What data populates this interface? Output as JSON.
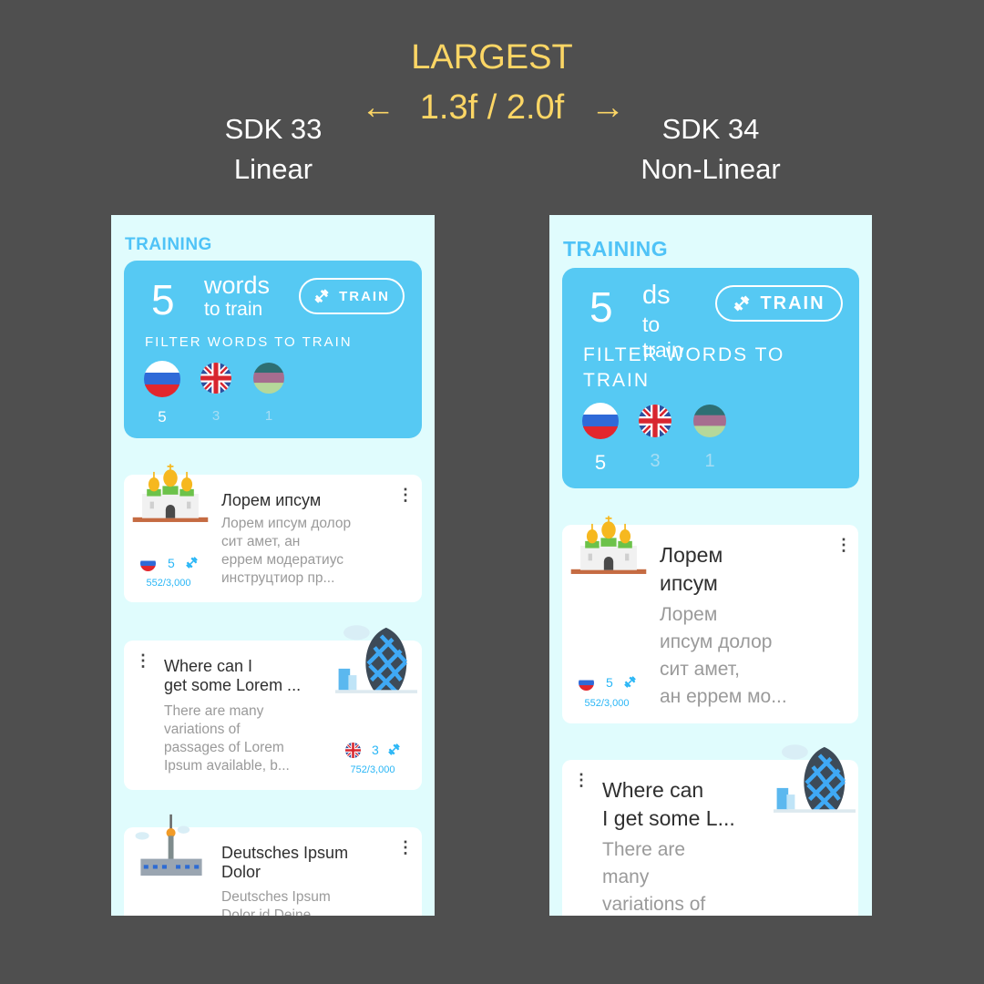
{
  "header": {
    "title": "LARGEST",
    "ratio": "1.3f / 2.0f",
    "left_arrow": "←",
    "right_arrow": "→",
    "left_sdk": "SDK 33",
    "left_mode": "Linear",
    "right_sdk": "SDK 34",
    "right_mode": "Non-Linear"
  },
  "left": {
    "section_title": "TRAINING",
    "count": "5",
    "words": "words",
    "to_train": "to train",
    "train_button": "TRAIN",
    "filter_label": "FILTER WORDS TO TRAIN",
    "filters": [
      {
        "flag": "russia-flag-icon",
        "count": "5"
      },
      {
        "flag": "uk-flag-icon",
        "count": "3"
      },
      {
        "flag": "german-style-flag-icon",
        "count": "1"
      }
    ],
    "items": [
      {
        "title": "Лорем ипсум",
        "desc_lines": [
          "Лорем ипсум долор",
          "сит амет, ан",
          "еррем модератиус",
          "инструцтиор пр..."
        ],
        "count": "5",
        "progress": "552/3,000",
        "image": "church-icon"
      },
      {
        "title_lines": [
          "Where can I",
          "get some Lorem ..."
        ],
        "desc_lines": [
          "There are many",
          "variations of",
          "passages of Lorem",
          "Ipsum available, b..."
        ],
        "count": "3",
        "progress": "752/3,000",
        "image": "gherkin-tower-icon"
      },
      {
        "title_lines": [
          "Deutsches Ipsum",
          "Dolor"
        ],
        "desc_lines": [
          "Deutsches Ipsum",
          "Dolor id Deine"
        ],
        "image": "tv-tower-icon"
      }
    ]
  },
  "right": {
    "section_title": "TRAINING",
    "count": "5",
    "words": "ds",
    "to_train_lines": [
      "to",
      "train"
    ],
    "train_button": "TRAIN",
    "filter_label_lines": [
      "FILTER WORDS TO",
      "TRAIN"
    ],
    "filters": [
      {
        "flag": "russia-flag-icon",
        "count": "5"
      },
      {
        "flag": "uk-flag-icon",
        "count": "3"
      },
      {
        "flag": "german-style-flag-icon",
        "count": "1"
      }
    ],
    "items": [
      {
        "title_lines": [
          "Лорем",
          "ипсум"
        ],
        "desc_lines": [
          "Лорем",
          "ипсум долор",
          "сит амет,",
          "ан еррем мо..."
        ],
        "count": "5",
        "progress": "552/3,000",
        "image": "church-icon"
      },
      {
        "title_lines": [
          "Where can",
          "I get some L..."
        ],
        "desc_lines": [
          "There are",
          "many",
          "variations of"
        ],
        "image": "gherkin-tower-icon"
      }
    ]
  },
  "colors": {
    "background": "#4f4f4f",
    "accent_yellow": "#fcd665",
    "phone_background": "#e0fcfd",
    "card_blue": "#56c9f3",
    "text_blue": "#4fc3f7"
  }
}
